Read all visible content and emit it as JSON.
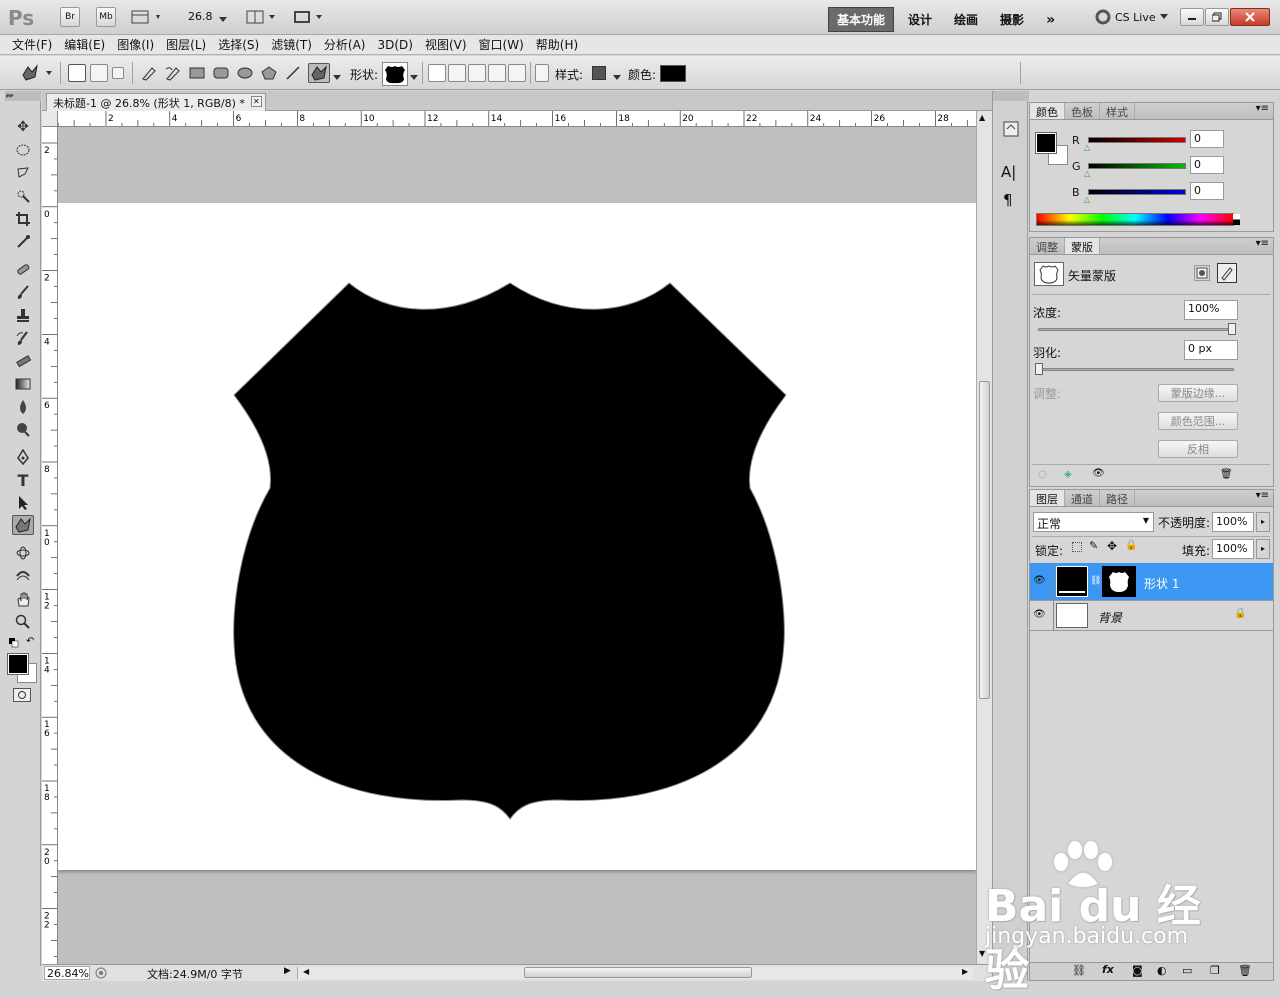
{
  "app": {
    "logo": "Ps",
    "bridge": "Br",
    "minibridge": "Mb",
    "zoom_value": "26.8",
    "workspaces": [
      "基本功能",
      "设计",
      "绘画",
      "摄影"
    ],
    "more": "»",
    "cslive": "CS Live"
  },
  "menu": [
    "文件(F)",
    "编辑(E)",
    "图像(I)",
    "图层(L)",
    "选择(S)",
    "滤镜(T)",
    "分析(A)",
    "3D(D)",
    "视图(V)",
    "窗口(W)",
    "帮助(H)"
  ],
  "options": {
    "shape_label": "形状:",
    "style_label": "样式:",
    "color_label": "颜色:",
    "color": "#000000"
  },
  "document": {
    "tab_title": "未标题-1 @ 26.8% (形状 1, RGB/8) *",
    "hruler_ticks": [
      "2",
      "4",
      "6",
      "8",
      "10",
      "12",
      "14",
      "16",
      "18",
      "20",
      "22",
      "24",
      "26",
      "28"
    ],
    "vruler_ticks": [
      "2",
      "0",
      "2",
      "4",
      "6",
      "8",
      "1 0",
      "1 2",
      "1 4",
      "1 6",
      "1 8",
      "2 0",
      "2 2"
    ],
    "shape_color": "#000000",
    "canvas_color": "#ffffff"
  },
  "status": {
    "zoom": "26.84%",
    "doc": "文档:24.9M/0 字节"
  },
  "color_panel": {
    "tabs": [
      "颜色",
      "色板",
      "样式"
    ],
    "channels": [
      {
        "name": "R",
        "value": "0",
        "color": "#d00000"
      },
      {
        "name": "G",
        "value": "0",
        "color": "#00b000"
      },
      {
        "name": "B",
        "value": "0",
        "color": "#0000d0"
      }
    ]
  },
  "mask_panel": {
    "tabs": [
      "调整",
      "蒙版"
    ],
    "title": "矢量蒙版",
    "density_label": "浓度:",
    "density_value": "100%",
    "feather_label": "羽化:",
    "feather_value": "0 px",
    "refine_label": "调整:",
    "mask_edge": "蒙版边缘...",
    "color_range": "颜色范围...",
    "invert": "反相"
  },
  "layers_panel": {
    "tabs": [
      "图层",
      "通道",
      "路径"
    ],
    "blend_mode": "正常",
    "opacity_label": "不透明度:",
    "opacity_value": "100%",
    "lock_label": "锁定:",
    "fill_label": "填充:",
    "fill_value": "100%",
    "layers": [
      {
        "name": "形状 1",
        "selected": true
      },
      {
        "name": "背景",
        "selected": false
      }
    ]
  },
  "watermark": {
    "brand": "Bai du 经验",
    "url": "jingyan.baidu.com"
  }
}
